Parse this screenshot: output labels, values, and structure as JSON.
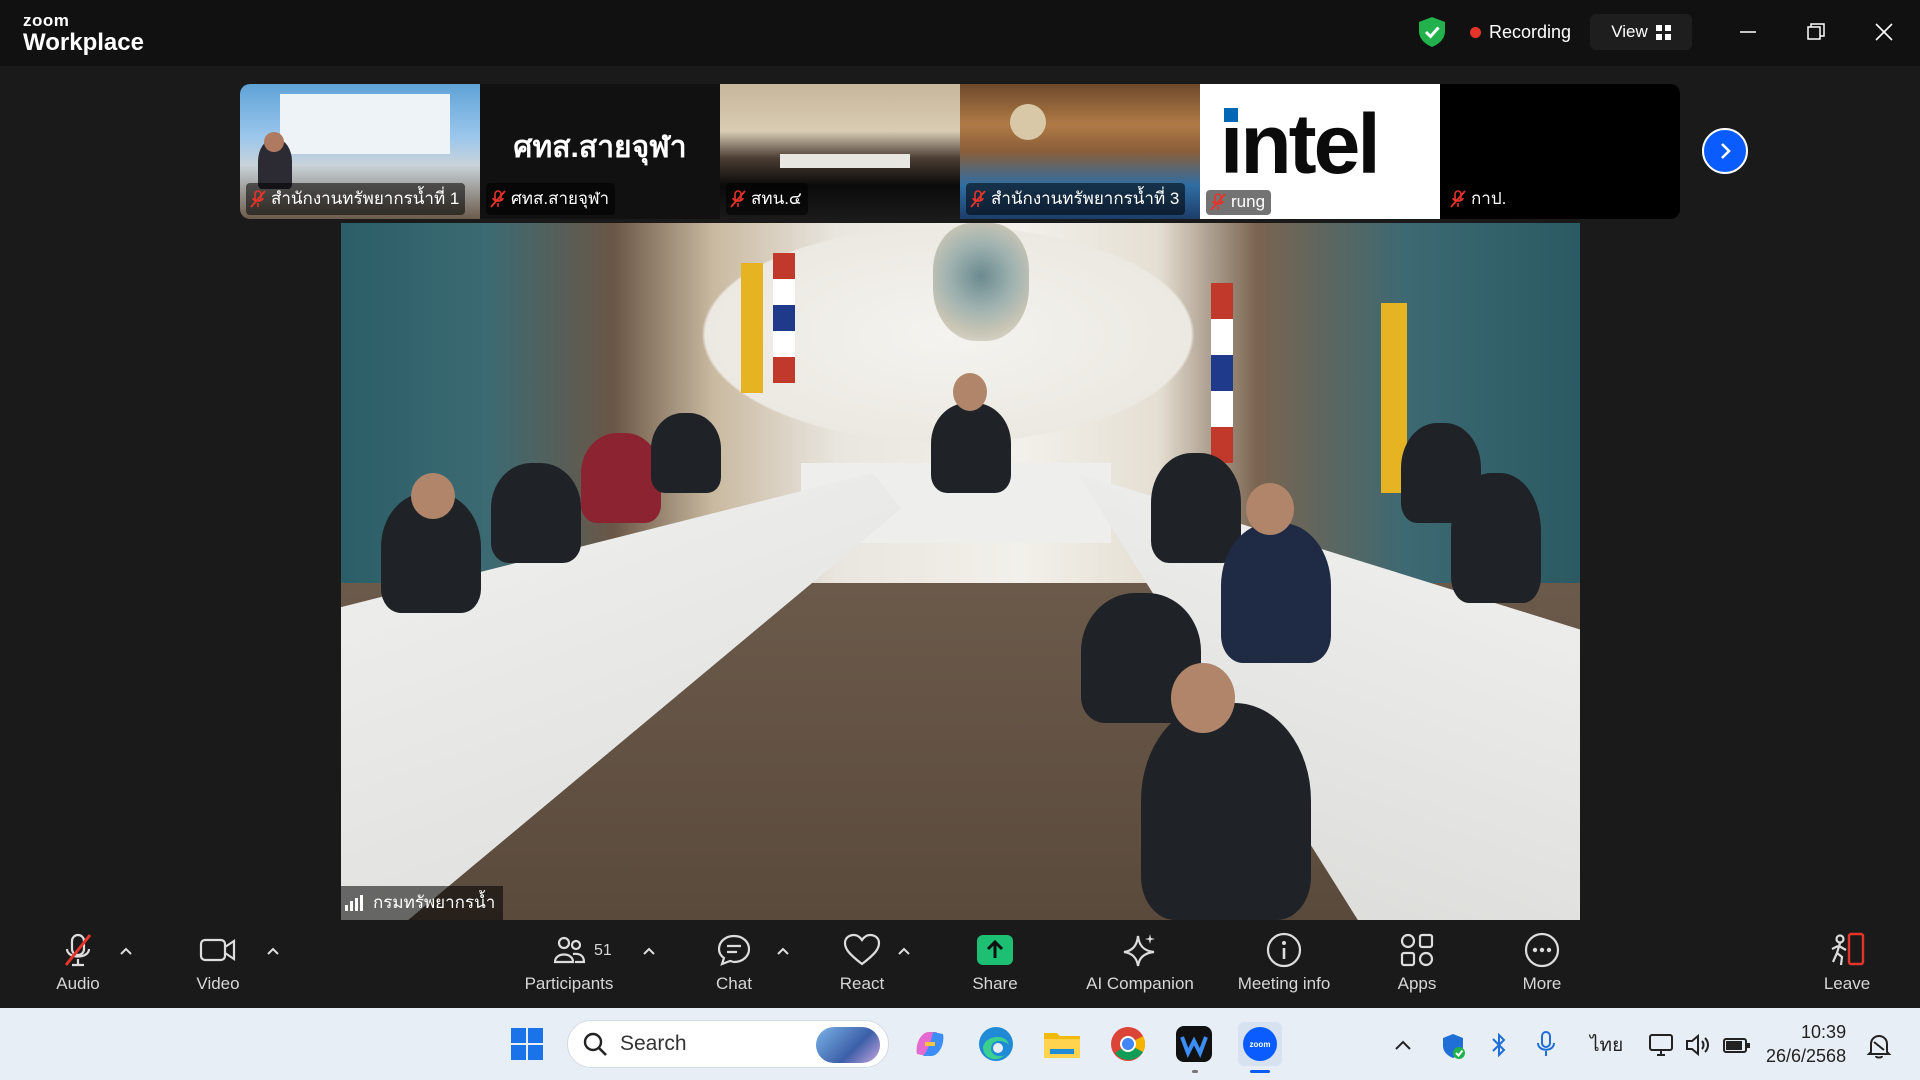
{
  "titlebar": {
    "brand_top": "zoom",
    "brand_bottom": "Workplace",
    "recording_label": "Recording",
    "view_label": "View"
  },
  "thumbnails": [
    {
      "name": "สำนักงานทรัพยากรน้ำที่ 1",
      "muted": true
    },
    {
      "name": "ศทส.สายจุฬา",
      "muted": true,
      "display_text": "ศทส.สายจุฬา"
    },
    {
      "name": "สทน.๔",
      "muted": true
    },
    {
      "name": "สำนักงานทรัพยากรน้ำที่ 3",
      "muted": true
    },
    {
      "name": "rung",
      "muted": true,
      "display_text": "intel"
    },
    {
      "name": "กาป.",
      "muted": true
    }
  ],
  "main_video": {
    "speaker_label": "กรมทรัพยากรน้ำ"
  },
  "toolbar": {
    "audio": "Audio",
    "video": "Video",
    "participants": "Participants",
    "participants_count": "51",
    "chat": "Chat",
    "react": "React",
    "share": "Share",
    "ai_companion": "AI Companion",
    "meeting_info": "Meeting info",
    "apps": "Apps",
    "more": "More",
    "leave": "Leave"
  },
  "taskbar": {
    "search_placeholder": "Search",
    "language": "ไทย",
    "time": "10:39",
    "date": "26/6/2568"
  },
  "colors": {
    "zoom_blue": "#0b5cff",
    "recording_red": "#e5352a",
    "share_green": "#1dbf73",
    "shield_green": "#22b14c",
    "muted_red": "#e5352a"
  }
}
